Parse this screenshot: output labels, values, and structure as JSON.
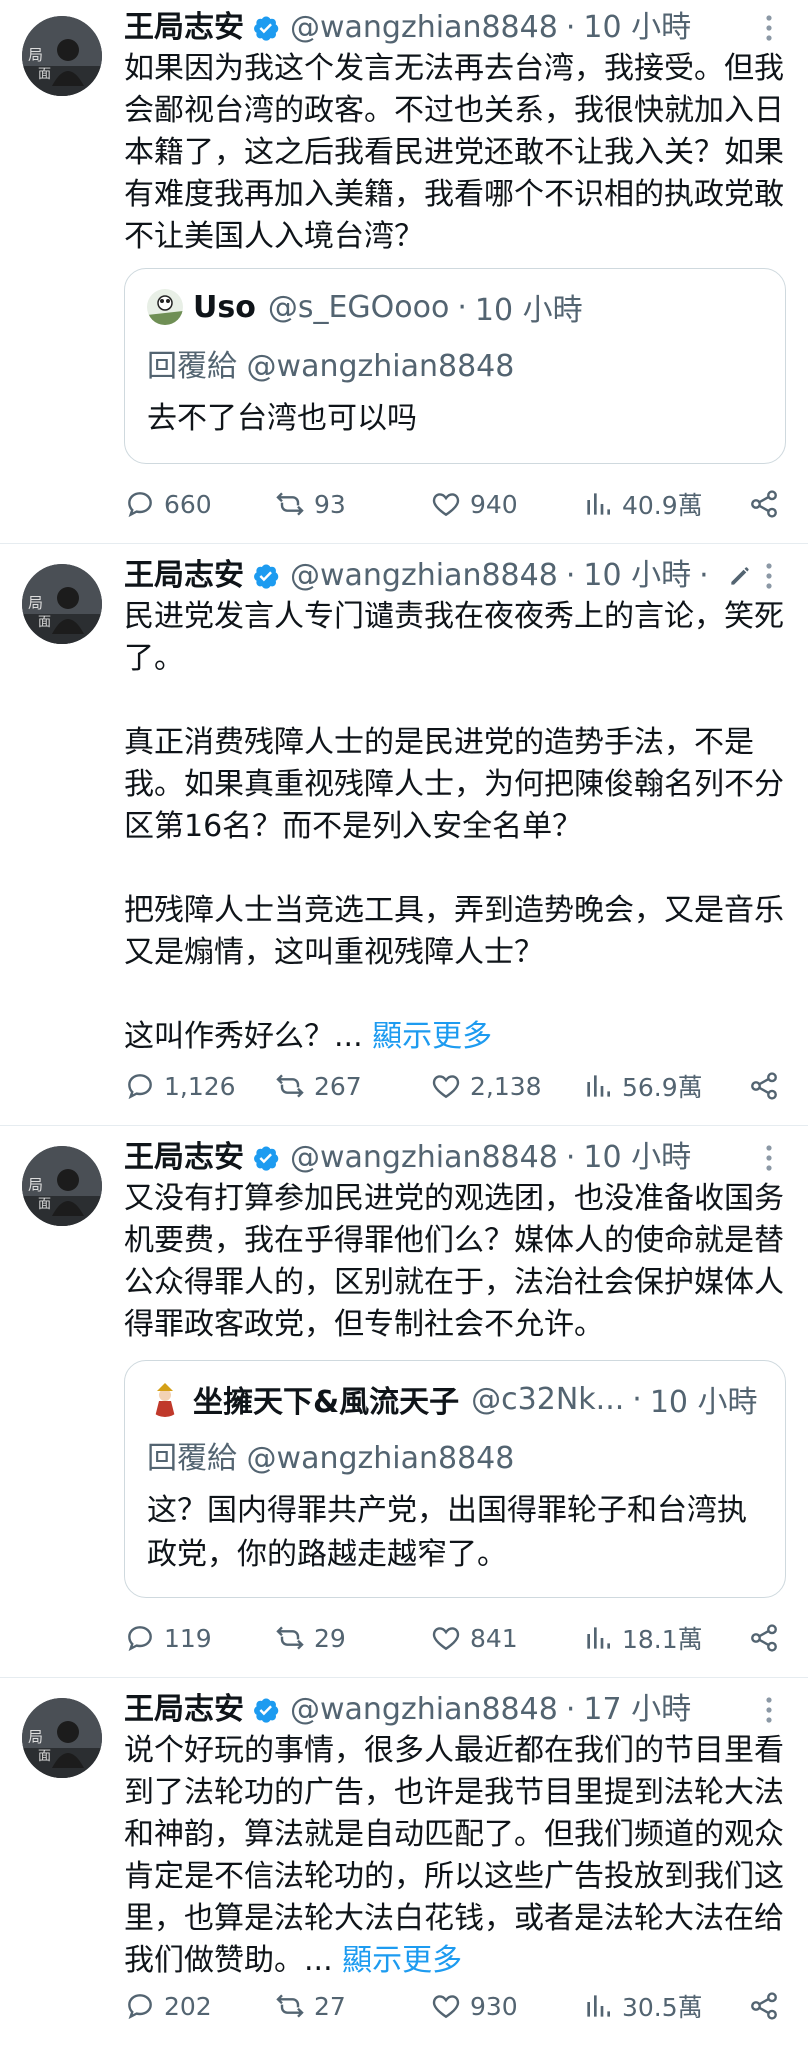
{
  "author": {
    "name": "王局志安",
    "handle": "@wangzhian8848"
  },
  "tweets": [
    {
      "time": "10 小時",
      "text": "如果因为我这个发言无法再去台湾，我接受。但我会鄙视台湾的政客。不过也关系，我很快就加入日本籍了，这之后我看民进党还敢不让我入关？如果有难度我再加入美籍，我看哪个不识相的执政党敢不让美国人入境台湾？",
      "quote": {
        "name": "Uso",
        "handle": "@s_EGOooo",
        "time": "10 小時",
        "reply_to": "回覆給 @wangzhian8848",
        "text": "去不了台湾也可以吗"
      },
      "stats": {
        "replies": "660",
        "retweets": "93",
        "likes": "940",
        "views": "40.9萬"
      }
    },
    {
      "time": "10 小時",
      "text": "民进党发言人专门谴责我在夜夜秀上的言论，笑死了。\n\n真正消费残障人士的是民进党的造势手法，不是我。如果真重视残障人士，为何把陳俊翰名列不分区第16名？而不是列入安全名单？\n\n把残障人士当竞选工具，弄到造势晚会，又是音乐又是煽情，这叫重视残障人士？\n\n这叫作秀好么？... ",
      "show_more": "顯示更多",
      "stats": {
        "replies": "1,126",
        "retweets": "267",
        "likes": "2,138",
        "views": "56.9萬"
      }
    },
    {
      "time": "10 小時",
      "text": "又没有打算参加民进党的观选团，也没准备收国务机要费，我在乎得罪他们么？媒体人的使命就是替公众得罪人的，区别就在于，法治社会保护媒体人得罪政客政党，但专制社会不允许。",
      "quote": {
        "name": "坐擁天下&風流天子",
        "handle": "@c32Nk...",
        "time": "10 小時",
        "reply_to": "回覆給 @wangzhian8848",
        "text": "这？国内得罪共产党，出国得罪轮子和台湾执政党，你的路越走越窄了。"
      },
      "stats": {
        "replies": "119",
        "retweets": "29",
        "likes": "841",
        "views": "18.1萬"
      }
    },
    {
      "time": "17 小時",
      "text": "说个好玩的事情，很多人最近都在我们的节目里看到了法轮功的广告，也许是我节目里提到法轮大法和神韵，算法就是自动匹配了。但我们频道的观众肯定是不信法轮功的，所以这些广告投放到我们这里，也算是法轮大法白花钱，或者是法轮大法在给我们做赞助。... ",
      "show_more": "顯示更多",
      "stats": {
        "replies": "202",
        "retweets": "27",
        "likes": "930",
        "views": "30.5萬"
      }
    }
  ],
  "colors": {
    "link": "#1d9bf0",
    "muted": "#536471",
    "verified": "#1d9bf0"
  }
}
